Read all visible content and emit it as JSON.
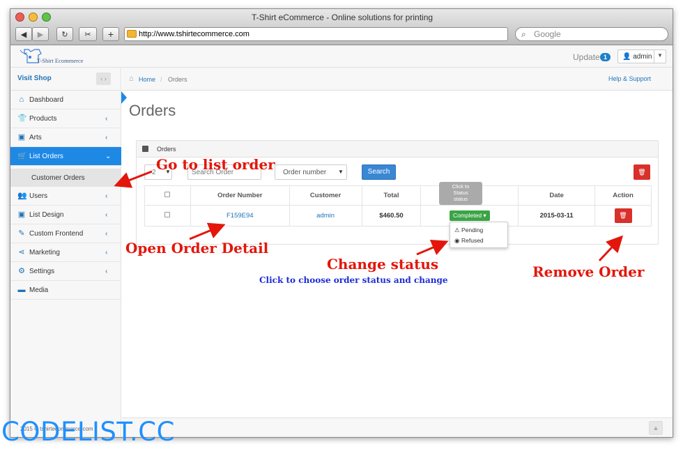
{
  "browser": {
    "window_title": "T-Shirt eCommerce - Online solutions for printing",
    "url": "http://www.tshirtecommerce.com",
    "search_placeholder": "Google"
  },
  "header": {
    "logo_text": "T-Shirt Ecommerce",
    "update_label": "Update",
    "update_count": "1",
    "user_label": "admin"
  },
  "sidebar": {
    "visit_shop": "Visit Shop",
    "items": [
      {
        "label": "Dashboard",
        "icon": "home-icon"
      },
      {
        "label": "Products",
        "icon": "tshirt-icon"
      },
      {
        "label": "Arts",
        "icon": "picture-icon"
      },
      {
        "label": "List Orders",
        "icon": "cart-icon"
      },
      {
        "label": "Users",
        "icon": "users-icon"
      },
      {
        "label": "List Design",
        "icon": "picture-icon"
      },
      {
        "label": "Custom Frontend",
        "icon": "pencil-icon"
      },
      {
        "label": "Marketing",
        "icon": "share-icon"
      },
      {
        "label": "Settings",
        "icon": "gear-icon"
      },
      {
        "label": "Media",
        "icon": "folder-icon"
      }
    ],
    "sub_item": "Customer Orders"
  },
  "breadcrumb": {
    "home": "Home",
    "current": "Orders",
    "help": "Help & Support"
  },
  "page_title": "Orders",
  "panel": {
    "title": "Orders",
    "page_size": "2",
    "search_placeholder": "Search Order",
    "filter_select": "Order number",
    "search_button": "Search",
    "columns": [
      "Order Number",
      "Customer",
      "Total",
      "",
      "Date",
      "Action"
    ],
    "rows": [
      {
        "order_number": "F159E94",
        "customer": "admin",
        "total": "$460.50",
        "status": "Completed",
        "date": "2015-03-11"
      }
    ],
    "tooltip": [
      "Click to",
      "Status",
      "status"
    ],
    "status_options": [
      "Pending",
      "Refused"
    ]
  },
  "footer": {
    "copyright": "2015 © tshirtecommerce.com"
  },
  "annotations": {
    "go_to_list": "Go to list order",
    "open_detail": "Open Order Detail",
    "change_status": "Change status",
    "change_status_sub": "Click to choose order status and change",
    "remove_order": "Remove Order"
  },
  "watermark": "CODELIST.CC",
  "colors": {
    "accent": "#1e88e5",
    "annotation": "#e3160b",
    "annotation_sub": "#1c2bd6",
    "status_completed": "#3ba445",
    "danger": "#d9302c"
  }
}
